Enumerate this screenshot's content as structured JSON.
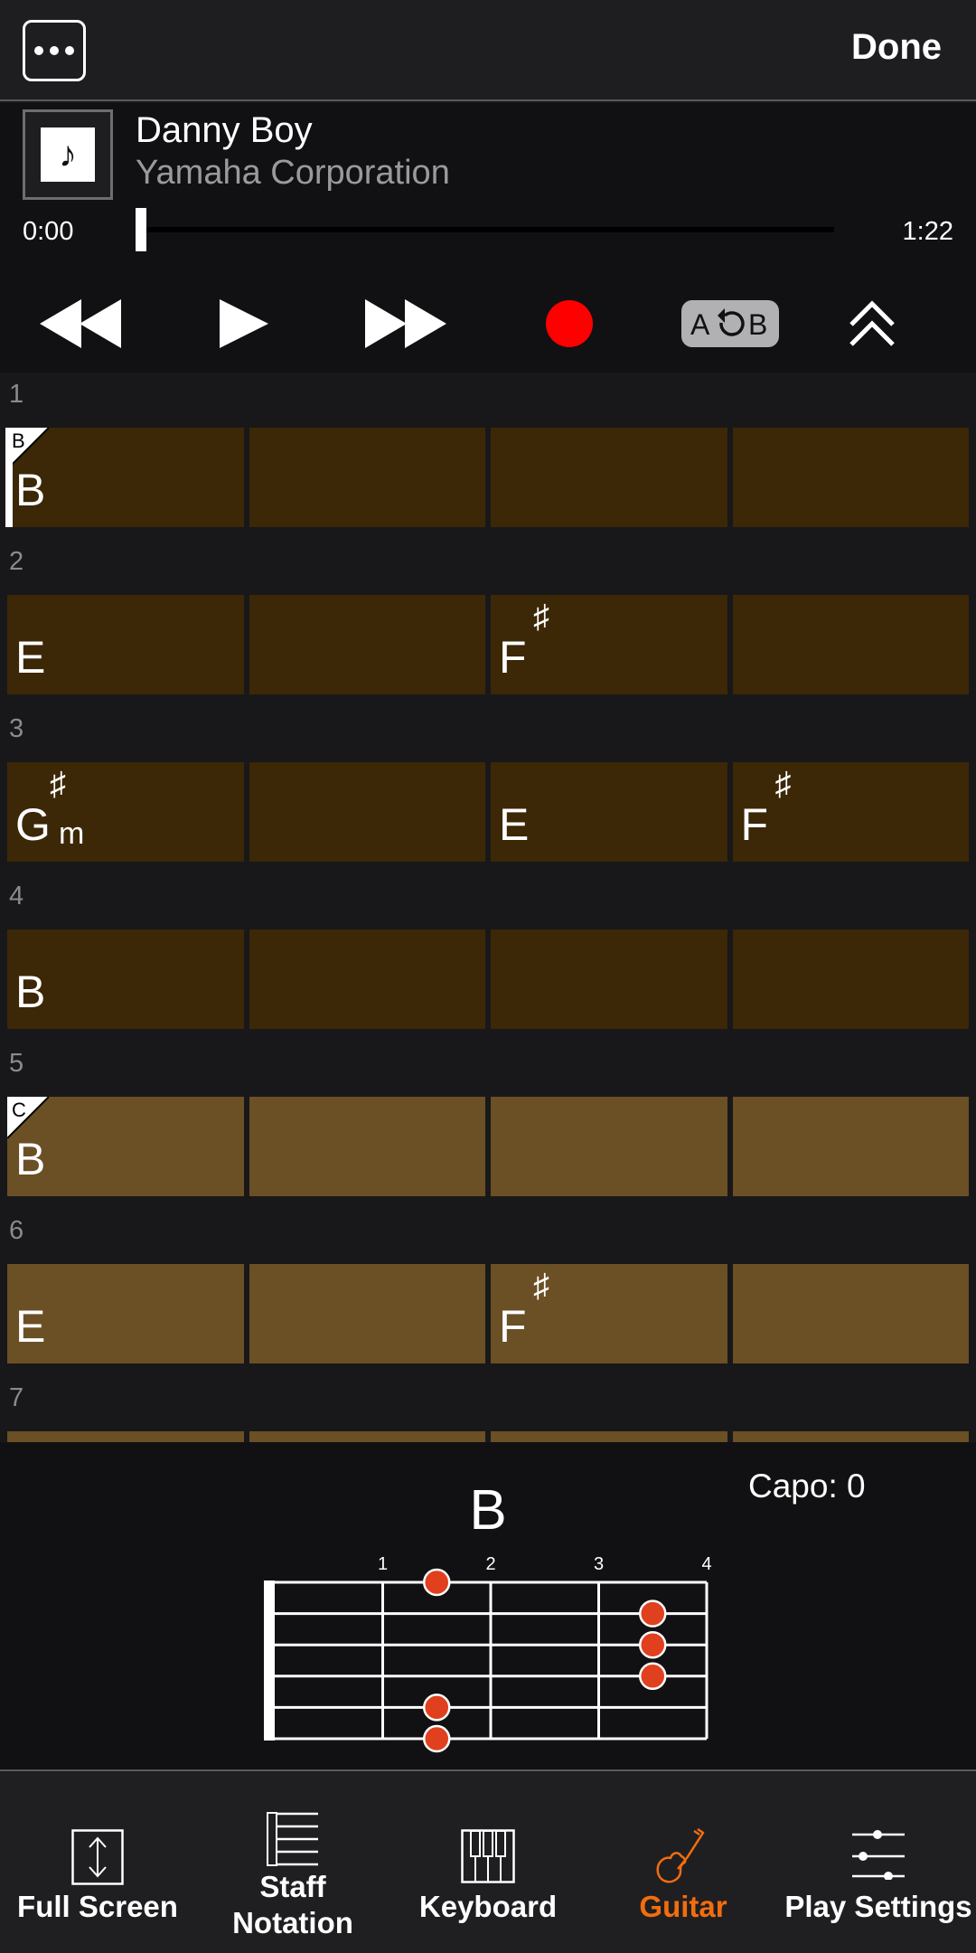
{
  "topbar": {
    "more_icon": "ellipsis-icon",
    "done_label": "Done"
  },
  "song": {
    "title": "Danny Boy",
    "artist": "Yamaha Corporation",
    "art_icon": "music-note-icon",
    "art_glyph": "♪"
  },
  "playback": {
    "current_time": "0:00",
    "total_time": "1:22",
    "progress": 0.0
  },
  "transport": {
    "rewind_icon": "rewind-icon",
    "play_icon": "play-icon",
    "fast_forward_icon": "fast-forward-icon",
    "record_icon": "record-icon",
    "record_color": "#ff0000",
    "ab_repeat": {
      "a": "A",
      "b": "B"
    },
    "collapse_icon": "double-chevron-up-icon"
  },
  "sheet": {
    "colors": {
      "section_b": "#3c2707",
      "section_c": "#6b4f25"
    },
    "bars": [
      {
        "number": "1",
        "section_marker": "B",
        "tone": "dark",
        "playhead": true,
        "beats": [
          {
            "root": "B",
            "acc": "",
            "qual": ""
          },
          {
            "root": "",
            "acc": "",
            "qual": ""
          },
          {
            "root": "",
            "acc": "",
            "qual": ""
          },
          {
            "root": "",
            "acc": "",
            "qual": ""
          }
        ]
      },
      {
        "number": "2",
        "section_marker": "",
        "tone": "dark",
        "playhead": false,
        "beats": [
          {
            "root": "E",
            "acc": "",
            "qual": ""
          },
          {
            "root": "",
            "acc": "",
            "qual": ""
          },
          {
            "root": "F",
            "acc": "♯",
            "qual": ""
          },
          {
            "root": "",
            "acc": "",
            "qual": ""
          }
        ]
      },
      {
        "number": "3",
        "section_marker": "",
        "tone": "dark",
        "playhead": false,
        "beats": [
          {
            "root": "G",
            "acc": "♯",
            "qual": "m"
          },
          {
            "root": "",
            "acc": "",
            "qual": ""
          },
          {
            "root": "E",
            "acc": "",
            "qual": ""
          },
          {
            "root": "F",
            "acc": "♯",
            "qual": ""
          }
        ]
      },
      {
        "number": "4",
        "section_marker": "",
        "tone": "dark",
        "playhead": false,
        "beats": [
          {
            "root": "B",
            "acc": "",
            "qual": ""
          },
          {
            "root": "",
            "acc": "",
            "qual": ""
          },
          {
            "root": "",
            "acc": "",
            "qual": ""
          },
          {
            "root": "",
            "acc": "",
            "qual": ""
          }
        ]
      },
      {
        "number": "5",
        "section_marker": "C",
        "tone": "light",
        "playhead": false,
        "beats": [
          {
            "root": "B",
            "acc": "",
            "qual": ""
          },
          {
            "root": "",
            "acc": "",
            "qual": ""
          },
          {
            "root": "",
            "acc": "",
            "qual": ""
          },
          {
            "root": "",
            "acc": "",
            "qual": ""
          }
        ]
      },
      {
        "number": "6",
        "section_marker": "",
        "tone": "light",
        "playhead": false,
        "beats": [
          {
            "root": "E",
            "acc": "",
            "qual": ""
          },
          {
            "root": "",
            "acc": "",
            "qual": ""
          },
          {
            "root": "F",
            "acc": "♯",
            "qual": ""
          },
          {
            "root": "",
            "acc": "",
            "qual": ""
          }
        ]
      },
      {
        "number": "7",
        "section_marker": "",
        "tone": "light",
        "playhead": false,
        "beats": [
          {
            "root": "",
            "acc": "",
            "qual": ""
          },
          {
            "root": "",
            "acc": "",
            "qual": ""
          },
          {
            "root": "",
            "acc": "",
            "qual": ""
          },
          {
            "root": "",
            "acc": "",
            "qual": ""
          }
        ]
      }
    ]
  },
  "guitar": {
    "chord_name": "B",
    "capo_label": "Capo: 0",
    "fret_numbers": [
      "1",
      "2",
      "3",
      "4"
    ],
    "dot_color": "#e0401e",
    "fingering": [
      {
        "string": 1,
        "fret": 2
      },
      {
        "string": 2,
        "fret": 4
      },
      {
        "string": 3,
        "fret": 4
      },
      {
        "string": 4,
        "fret": 4
      },
      {
        "string": 5,
        "fret": 2
      },
      {
        "string": 6,
        "fret": 2
      }
    ]
  },
  "nav": {
    "active_color": "#f26d0f",
    "items": [
      {
        "label_lines": [
          "Full Screen"
        ],
        "icon": "fullscreen-icon",
        "active": false
      },
      {
        "label_lines": [
          "Staff",
          "Notation"
        ],
        "icon": "staff-notation-icon",
        "active": false
      },
      {
        "label_lines": [
          "Keyboard"
        ],
        "icon": "keyboard-icon",
        "active": false
      },
      {
        "label_lines": [
          "Guitar"
        ],
        "icon": "guitar-icon",
        "active": true
      },
      {
        "label_lines": [
          "Play Settings"
        ],
        "icon": "sliders-icon",
        "active": false
      }
    ]
  }
}
